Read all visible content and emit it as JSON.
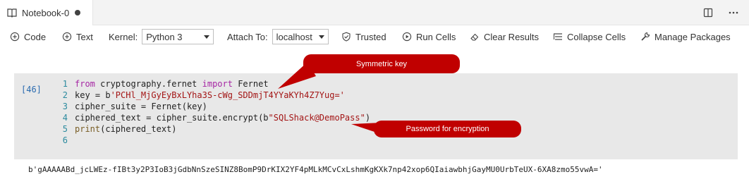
{
  "tab": {
    "title": "Notebook-0",
    "dirty": true
  },
  "icons": {
    "tab_icon": "book-icon",
    "split": "split-editor-icon",
    "more": "more-icon"
  },
  "toolbar": {
    "code_label": "Code",
    "text_label": "Text",
    "kernel_label": "Kernel:",
    "kernel_value": "Python 3",
    "attach_label": "Attach To:",
    "attach_value": "localhost",
    "trusted_label": "Trusted",
    "run_cells_label": "Run Cells",
    "clear_results_label": "Clear Results",
    "collapse_cells_label": "Collapse Cells",
    "manage_packages_label": "Manage Packages"
  },
  "cell": {
    "execution_count": "[46]",
    "lines": [
      {
        "num": "1",
        "tokens": [
          {
            "t": "from",
            "c": "kw"
          },
          {
            "t": " cryptography.fernet ",
            "c": "id"
          },
          {
            "t": "import",
            "c": "kw"
          },
          {
            "t": " Fernet",
            "c": "id"
          }
        ]
      },
      {
        "num": "2",
        "tokens": [
          {
            "t": "key = b",
            "c": "id"
          },
          {
            "t": "'PCHl_MjGyEyBxLYha3S-cWg_SDDmjT4YYaKYh4Z7Yug='",
            "c": "str"
          }
        ]
      },
      {
        "num": "3",
        "tokens": [
          {
            "t": "cipher_suite = Fernet(key)",
            "c": "id"
          }
        ]
      },
      {
        "num": "4",
        "tokens": [
          {
            "t": "ciphered_text = cipher_suite.encrypt(b",
            "c": "id"
          },
          {
            "t": "\"SQLShack@DemoPass\"",
            "c": "str"
          },
          {
            "t": ")",
            "c": "id"
          }
        ]
      },
      {
        "num": "5",
        "tokens": [
          {
            "t": "print",
            "c": "fn"
          },
          {
            "t": "(ciphered_text)",
            "c": "id"
          }
        ]
      },
      {
        "num": "6",
        "tokens": []
      }
    ]
  },
  "output": {
    "text": "b'gAAAAABd_jcLWEz-fIBt3y2P3IoB3jGdbNnSzeSINZ8BomP9DrKIX2YF4pMLkMCvCxLshmKgKXk7np42xop6QIaiawbhjGayMU0UrbTeUX-6XA8zmo55vwA='"
  },
  "annotations": {
    "symmetric_key": "Symmetric key",
    "password": "Password for encryption"
  },
  "colors": {
    "callout": "#c00000",
    "keyword": "#a626a4",
    "string": "#a31515",
    "line_number": "#2b8a9e",
    "execution_count": "#2b6cb0",
    "cell_background": "#e8e8e8"
  }
}
